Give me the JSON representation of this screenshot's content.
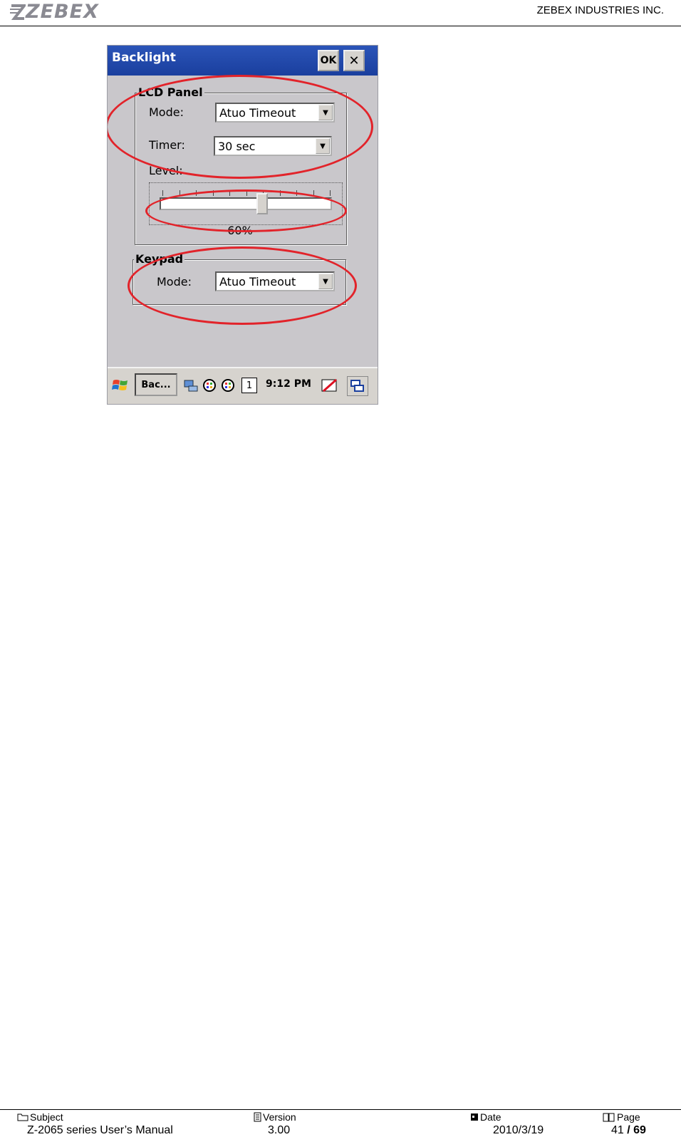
{
  "header": {
    "logo_text": "ZEBEX",
    "company": "ZEBEX INDUSTRIES INC."
  },
  "dialog": {
    "title": "Backlight",
    "ok_label": "OK",
    "close_label": "✕",
    "lcd_panel": {
      "legend": "LCD Panel",
      "mode_label": "Mode:",
      "mode_value": "Atuo Timeout",
      "timer_label": "Timer:",
      "timer_value": "30 sec",
      "level_label": "Level:",
      "level_value": 0.6,
      "level_text": "60%"
    },
    "keypad": {
      "legend": "Keypad",
      "mode_label": "Mode:",
      "mode_value": "Atuo Timeout"
    }
  },
  "taskbar": {
    "app_button": "Bac...",
    "clock": "9:12 PM",
    "input_indicator": "1"
  },
  "footer": {
    "subject_label": "Subject",
    "subject_value": "Z-2065 series User’s Manual",
    "version_label": "Version",
    "version_value": "3.00",
    "date_label": "Date",
    "date_value": "2010/3/19",
    "page_label": "Page",
    "page_current": "41",
    "page_total": "/ 69"
  },
  "colors": {
    "annotation_red": "#e2232a",
    "titlebar_blue": "#1a3f9e",
    "dialog_gray": "#c9c7cb"
  }
}
